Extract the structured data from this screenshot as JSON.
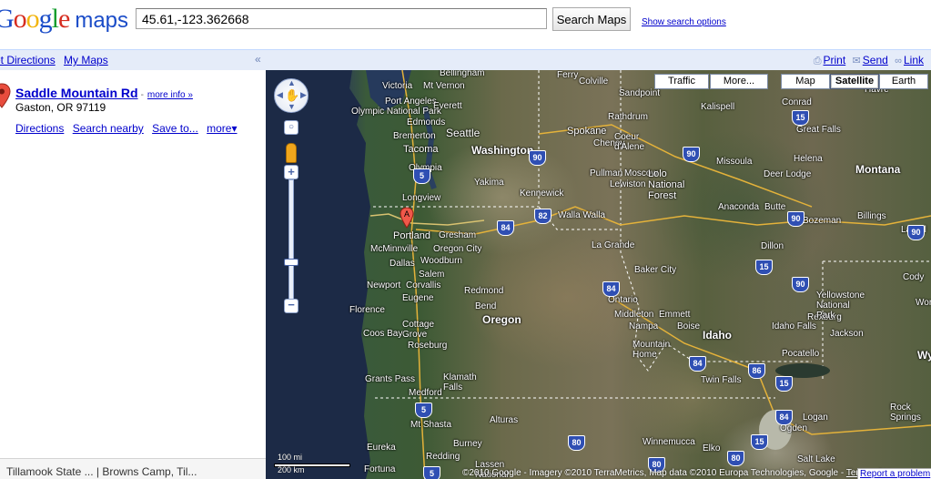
{
  "header": {
    "logo_google": [
      "G",
      "o",
      "o",
      "g",
      "l",
      "e"
    ],
    "logo_maps": "maps",
    "search_value": "45.61,-123.362668",
    "search_button": "Search Maps",
    "search_options": "Show search options"
  },
  "topbar": {
    "get_directions": "et Directions",
    "my_maps": "My Maps",
    "collapse": "«",
    "print": "Print",
    "send": "Send",
    "link": "Link"
  },
  "result": {
    "title": "Saddle Mountain Rd",
    "dash": "-",
    "more_info": "more info »",
    "address": "Gaston, OR 97119",
    "actions": [
      "Directions",
      "Search nearby",
      "Save to...",
      "more▾"
    ]
  },
  "bottom_bar": "Tillamook State ... | Browns Camp, Til...",
  "map": {
    "types": [
      "Traffic",
      "More...",
      "Map",
      "Satellite",
      "Earth"
    ],
    "active_type": "Satellite",
    "marker_letter": "A",
    "scale": {
      "mi": "100 mi",
      "km": "200 km"
    },
    "copyright": "©2010 Google - Imagery ©2010 TerraMetrics, Map data ©2010 Europa Technologies, Google -",
    "terms": "Terms of Use",
    "report": "Report a problem",
    "colors": {
      "water": "#23324f",
      "shield": "#2f4fb3",
      "link": "#0000cc",
      "topbar": "#e5ecf9"
    },
    "places": [
      "Bellingham",
      "Victoria",
      "Mt Vernon",
      "Port Angeles",
      "Everett",
      "Olympic National Park",
      "Edmonds",
      "Bremerton",
      "Seattle",
      "Tacoma",
      "Olympia",
      "Longview",
      "Portland",
      "Gresham",
      "McMinnville",
      "Oregon City",
      "Woodburn",
      "Dallas",
      "Salem",
      "Newport",
      "Corvallis",
      "Eugene",
      "Florence",
      "Cottage Grove",
      "Coos Bay",
      "Roseburg",
      "Grants Pass",
      "Medford",
      "Klamath Falls",
      "Mt Shasta",
      "Eureka",
      "Redding",
      "Fortuna",
      "Burney",
      "Alturas",
      "Lassen National Forest",
      "Redmond",
      "Bend",
      "Kennewick",
      "Walla Walla",
      "Yakima",
      "Pullman",
      "Moscow",
      "Lewiston",
      "Spokane",
      "Cheney",
      "Coeur d'Alene",
      "Rathdrum",
      "Sandpoint",
      "Colville",
      "Kalispell",
      "Conrad",
      "Great Falls",
      "Havre",
      "Missoula",
      "Helena",
      "Deer Lodge",
      "Anaconda",
      "Butte",
      "Bozeman",
      "Billings",
      "Laurel",
      "La Grande",
      "Baker City",
      "Ontario",
      "Middleton",
      "Emmett",
      "Nampa",
      "Boise",
      "Mountain Home",
      "Twin Falls",
      "Idaho Falls",
      "Rexburg",
      "Pocatello",
      "Jackson",
      "Cody",
      "Yellowstone National Park",
      "Dillon",
      "Elko",
      "Winnemucca",
      "Logan",
      "Ogden",
      "Rock Springs",
      "Salt Lake",
      "Lolo National Forest",
      "Ferry"
    ],
    "regions": [
      "Washington",
      "Oregon",
      "Idaho",
      "Montana",
      "Wy",
      "Wor"
    ],
    "shields": [
      "5",
      "5",
      "5",
      "90",
      "90",
      "82",
      "84",
      "84",
      "84",
      "90",
      "90",
      "15",
      "15",
      "15",
      "15",
      "86",
      "80",
      "80",
      "80",
      "90",
      "84"
    ]
  }
}
